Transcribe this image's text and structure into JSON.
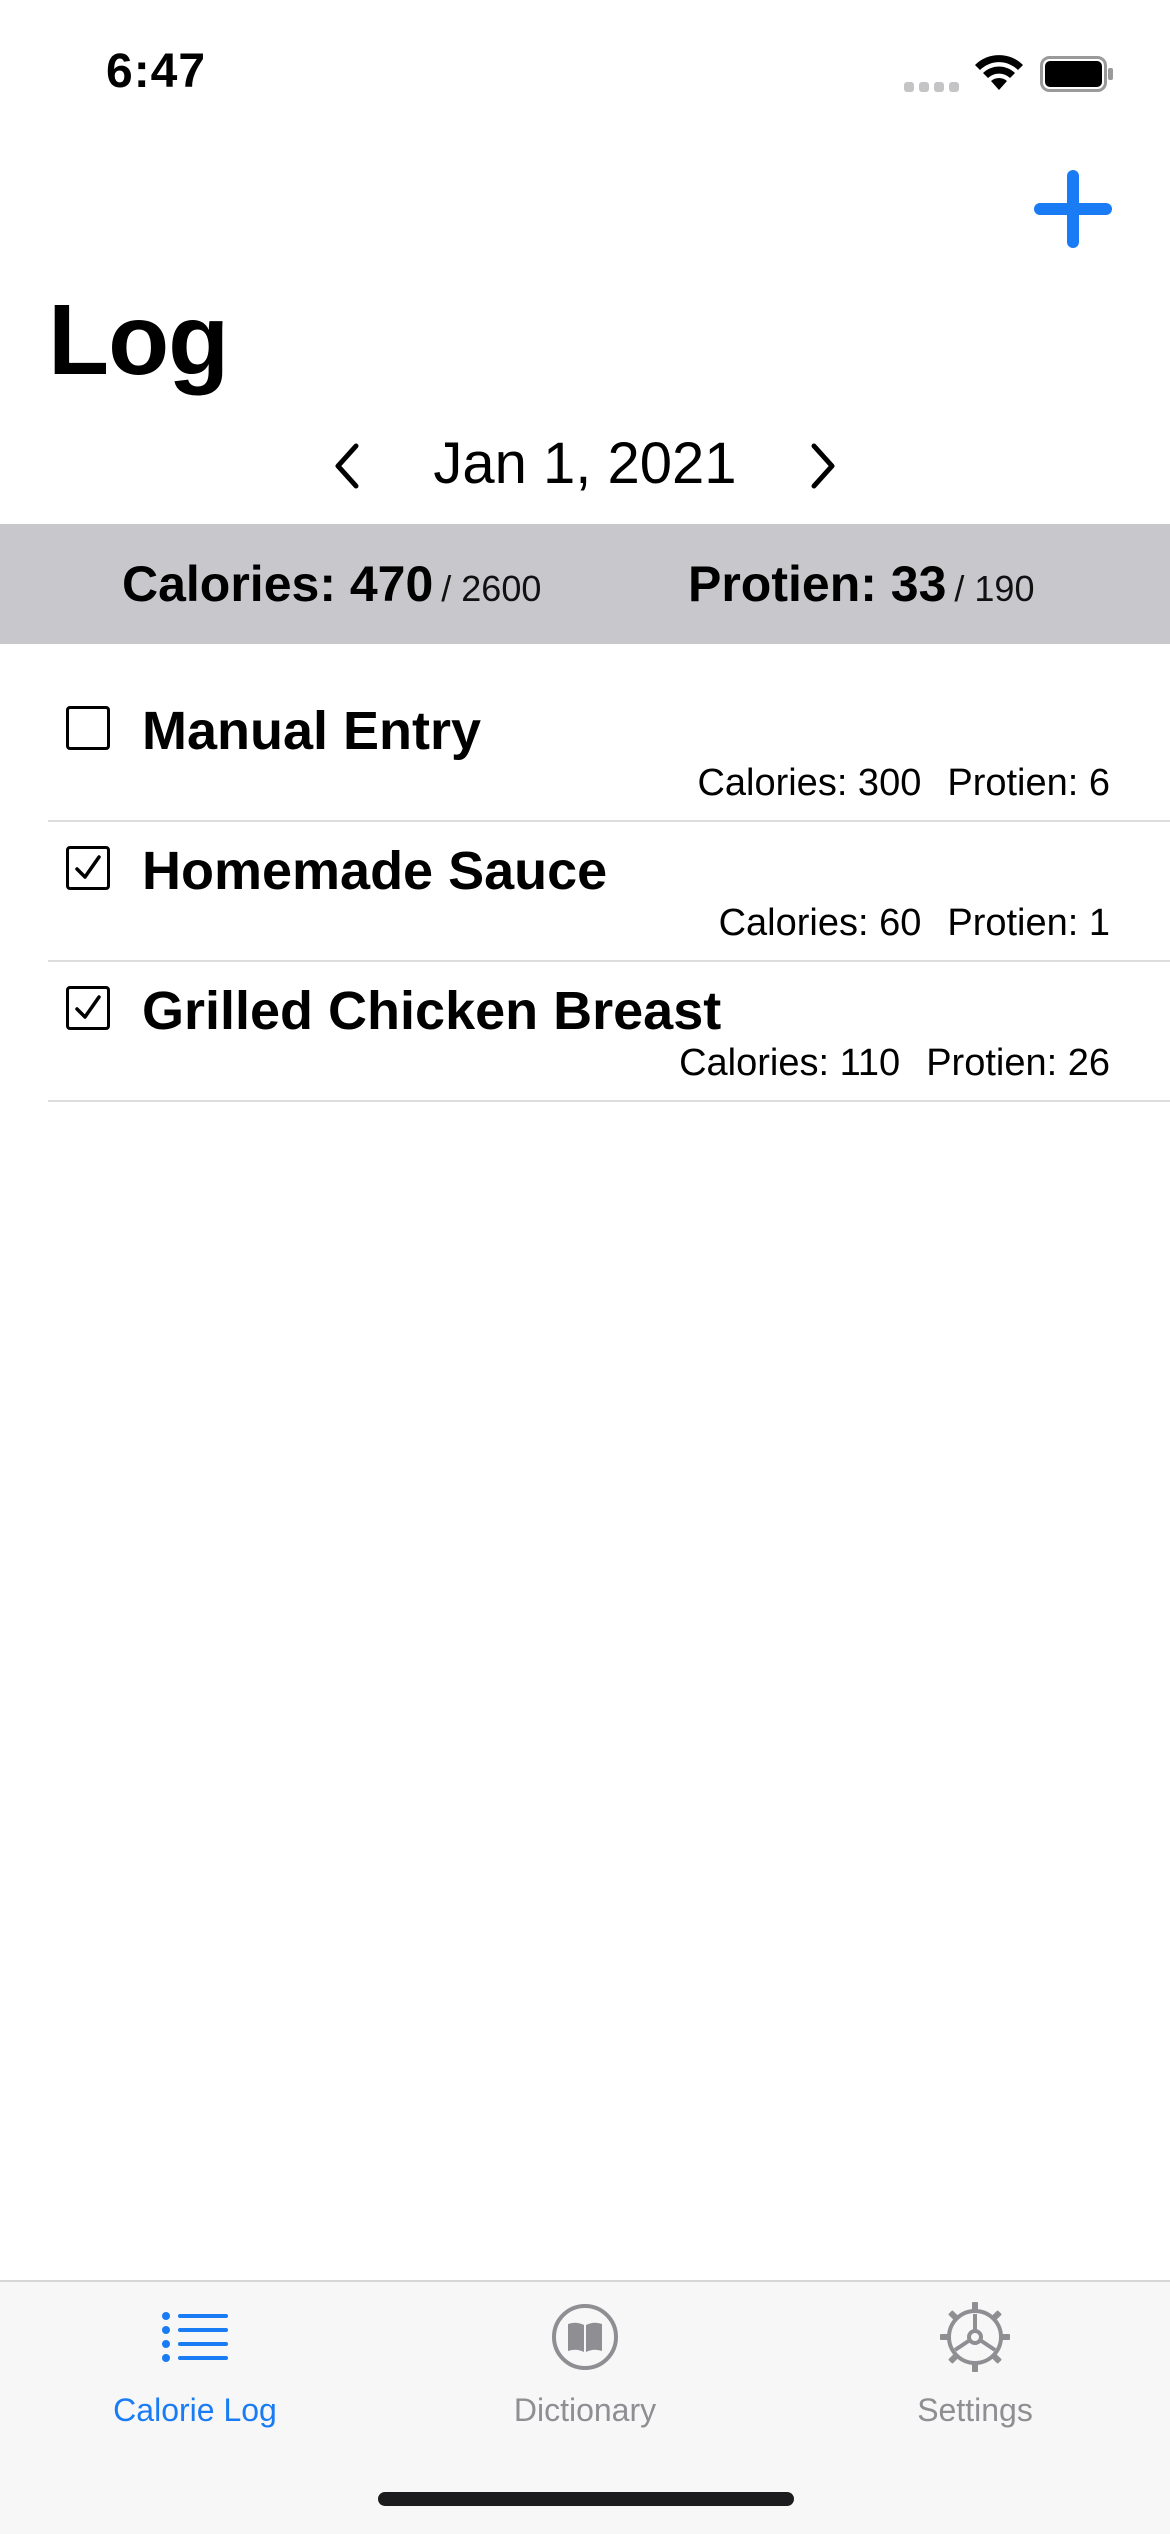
{
  "status": {
    "time": "6:47"
  },
  "header": {
    "title": "Log"
  },
  "date": {
    "label": "Jan 1, 2021"
  },
  "summary": {
    "calories_label": "Calories: 470",
    "calories_target": "/ 2600",
    "protein_label": "Protien: 33",
    "protein_target": "/ 190"
  },
  "entries": [
    {
      "name": "Manual Entry",
      "checked": false,
      "calories": "Calories: 300",
      "protein": "Protien: 6"
    },
    {
      "name": "Homemade Sauce",
      "checked": true,
      "calories": "Calories: 60",
      "protein": "Protien: 1"
    },
    {
      "name": "Grilled Chicken Breast",
      "checked": true,
      "calories": "Calories: 110",
      "protein": "Protien: 26"
    }
  ],
  "tabs": [
    {
      "label": "Calorie Log",
      "icon": "list-bullet-icon",
      "active": true
    },
    {
      "label": "Dictionary",
      "icon": "book-circle-icon",
      "active": false
    },
    {
      "label": "Settings",
      "icon": "gear-icon",
      "active": false
    }
  ],
  "colors": {
    "accent": "#1a7cf5",
    "summary_band": "#c8c8cc",
    "inactive": "#8e8e93"
  }
}
